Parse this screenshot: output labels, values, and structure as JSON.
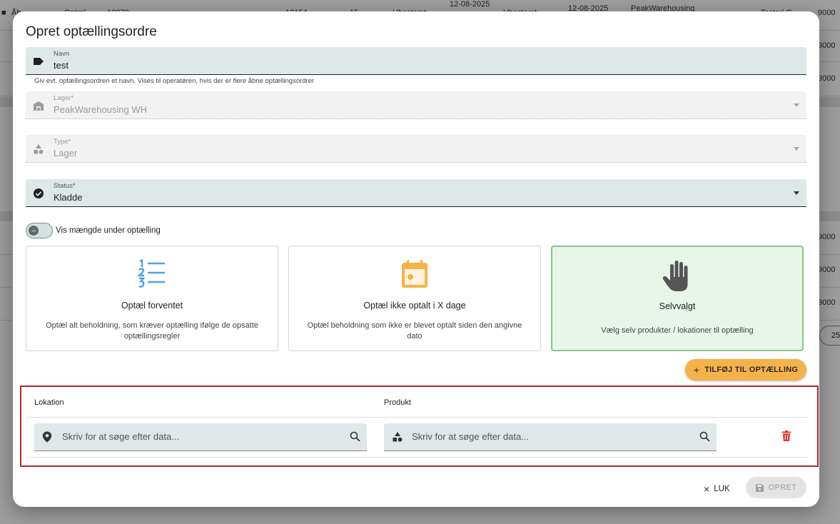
{
  "background": {
    "rows": [
      {
        "cells": [
          "Åb",
          "Optæl...",
          "10070",
          "12154",
          "15",
          "Ubestemt",
          "12-08-2025",
          "Ubestemt",
          "12-08-2025",
          "PeakWarehousing",
          "Testeri G",
          "9000"
        ]
      },
      {
        "cells": [
          "",
          "9000"
        ]
      },
      {
        "cells": [
          "",
          "9000"
        ]
      },
      {
        "cells": [
          "",
          "9000"
        ]
      },
      {
        "cells": [
          "",
          "9000"
        ]
      },
      {
        "cells": [
          "",
          "9000"
        ]
      },
      {
        "cells": [
          "25"
        ]
      }
    ]
  },
  "dialog": {
    "title": "Opret optællingsordre",
    "name_field": {
      "label": "Navn",
      "value": "test",
      "helper": "Giv evt. optællingsordren et navn. Vises til operatøren, hvis der er flere åbne optællingsordrer"
    },
    "warehouse_field": {
      "label": "Lager*",
      "value": "PeakWarehousing WH"
    },
    "type_field": {
      "label": "Type*",
      "value": "Lager"
    },
    "status_field": {
      "label": "Status*",
      "value": "Kladde"
    },
    "toggle_label": "Vis mængde under optælling",
    "cards": [
      {
        "title": "Optæl forventet",
        "description": "Optæl alt beholdning, som kræver optælling ifølge de opsatte optællingsregler",
        "icon": "numbered-list-icon",
        "selected": false
      },
      {
        "title": "Optæl ikke optalt i X dage",
        "description": "Optæl beholdning som ikke er blevet optalt siden den angivne dato",
        "icon": "calendar-icon",
        "selected": false
      },
      {
        "title": "Selvvalgt",
        "description": "Vælg selv produkter / lokationer til optælling",
        "icon": "hand-icon",
        "selected": true
      }
    ],
    "add_button": "TILFØJ TIL OPTÆLLING",
    "table": {
      "headers": {
        "location": "Lokation",
        "product": "Produkt"
      },
      "location_placeholder": "Skriv for at søge efter data...",
      "product_placeholder": "Skriv for at søge efter data..."
    },
    "close_button": "LUK",
    "create_button": "OPRET"
  },
  "colors": {
    "accent": "#f6b24a",
    "selected_card_bg": "#e8f5e8",
    "selected_card_border": "#86c786",
    "field_bg": "#dfe7e8",
    "highlight_border": "#b3262b",
    "delete": "#e53935"
  }
}
